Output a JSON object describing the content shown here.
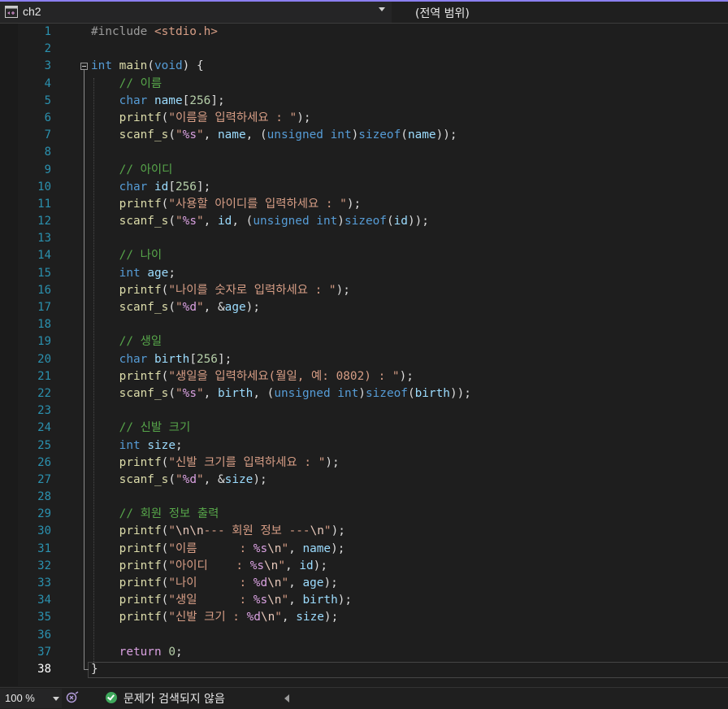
{
  "navbar": {
    "project_name": "ch2",
    "scope": "(전역 범위)"
  },
  "editor": {
    "current_line": 38,
    "lines": [
      {
        "n": "1",
        "tokens": [
          {
            "t": "#include ",
            "c": "pp"
          },
          {
            "t": "<stdio.h>",
            "c": "inc"
          }
        ]
      },
      {
        "n": "2",
        "tokens": []
      },
      {
        "n": "3",
        "tokens": [
          {
            "t": "int",
            "c": "kw"
          },
          {
            "t": " "
          },
          {
            "t": "main",
            "c": "fn"
          },
          {
            "t": "("
          },
          {
            "t": "void",
            "c": "kw"
          },
          {
            "t": ") {"
          }
        ]
      },
      {
        "n": "4",
        "tokens": [
          {
            "t": "    "
          },
          {
            "t": "// 이름",
            "c": "cm"
          }
        ]
      },
      {
        "n": "5",
        "tokens": [
          {
            "t": "    "
          },
          {
            "t": "char",
            "c": "kw"
          },
          {
            "t": " "
          },
          {
            "t": "name",
            "c": "var"
          },
          {
            "t": "["
          },
          {
            "t": "256",
            "c": "num"
          },
          {
            "t": "];"
          }
        ]
      },
      {
        "n": "6",
        "tokens": [
          {
            "t": "    "
          },
          {
            "t": "printf",
            "c": "fn"
          },
          {
            "t": "("
          },
          {
            "t": "\"이름을 입력하세요 : \"",
            "c": "str"
          },
          {
            "t": ");"
          }
        ]
      },
      {
        "n": "7",
        "tokens": [
          {
            "t": "    "
          },
          {
            "t": "scanf_s",
            "c": "fn"
          },
          {
            "t": "("
          },
          {
            "t": "\"",
            "c": "str"
          },
          {
            "t": "%s",
            "c": "fmt"
          },
          {
            "t": "\"",
            "c": "str"
          },
          {
            "t": ", "
          },
          {
            "t": "name",
            "c": "var"
          },
          {
            "t": ", ("
          },
          {
            "t": "unsigned int",
            "c": "kw"
          },
          {
            "t": ")"
          },
          {
            "t": "sizeof",
            "c": "kw"
          },
          {
            "t": "("
          },
          {
            "t": "name",
            "c": "var"
          },
          {
            "t": "));"
          }
        ]
      },
      {
        "n": "8",
        "tokens": []
      },
      {
        "n": "9",
        "tokens": [
          {
            "t": "    "
          },
          {
            "t": "// 아이디",
            "c": "cm"
          }
        ]
      },
      {
        "n": "10",
        "tokens": [
          {
            "t": "    "
          },
          {
            "t": "char",
            "c": "kw"
          },
          {
            "t": " "
          },
          {
            "t": "id",
            "c": "var"
          },
          {
            "t": "["
          },
          {
            "t": "256",
            "c": "num"
          },
          {
            "t": "];"
          }
        ]
      },
      {
        "n": "11",
        "tokens": [
          {
            "t": "    "
          },
          {
            "t": "printf",
            "c": "fn"
          },
          {
            "t": "("
          },
          {
            "t": "\"사용할 아이디를 입력하세요 : \"",
            "c": "str"
          },
          {
            "t": ");"
          }
        ]
      },
      {
        "n": "12",
        "tokens": [
          {
            "t": "    "
          },
          {
            "t": "scanf_s",
            "c": "fn"
          },
          {
            "t": "("
          },
          {
            "t": "\"",
            "c": "str"
          },
          {
            "t": "%s",
            "c": "fmt"
          },
          {
            "t": "\"",
            "c": "str"
          },
          {
            "t": ", "
          },
          {
            "t": "id",
            "c": "var"
          },
          {
            "t": ", ("
          },
          {
            "t": "unsigned int",
            "c": "kw"
          },
          {
            "t": ")"
          },
          {
            "t": "sizeof",
            "c": "kw"
          },
          {
            "t": "("
          },
          {
            "t": "id",
            "c": "var"
          },
          {
            "t": "));"
          }
        ]
      },
      {
        "n": "13",
        "tokens": []
      },
      {
        "n": "14",
        "tokens": [
          {
            "t": "    "
          },
          {
            "t": "// 나이",
            "c": "cm"
          }
        ]
      },
      {
        "n": "15",
        "tokens": [
          {
            "t": "    "
          },
          {
            "t": "int",
            "c": "kw"
          },
          {
            "t": " "
          },
          {
            "t": "age",
            "c": "var"
          },
          {
            "t": ";"
          }
        ]
      },
      {
        "n": "16",
        "tokens": [
          {
            "t": "    "
          },
          {
            "t": "printf",
            "c": "fn"
          },
          {
            "t": "("
          },
          {
            "t": "\"나이를 숫자로 입력하세요 : \"",
            "c": "str"
          },
          {
            "t": ");"
          }
        ]
      },
      {
        "n": "17",
        "tokens": [
          {
            "t": "    "
          },
          {
            "t": "scanf_s",
            "c": "fn"
          },
          {
            "t": "("
          },
          {
            "t": "\"",
            "c": "str"
          },
          {
            "t": "%d",
            "c": "fmt"
          },
          {
            "t": "\"",
            "c": "str"
          },
          {
            "t": ", &"
          },
          {
            "t": "age",
            "c": "var"
          },
          {
            "t": ");"
          }
        ]
      },
      {
        "n": "18",
        "tokens": []
      },
      {
        "n": "19",
        "tokens": [
          {
            "t": "    "
          },
          {
            "t": "// 생일",
            "c": "cm"
          }
        ]
      },
      {
        "n": "20",
        "tokens": [
          {
            "t": "    "
          },
          {
            "t": "char",
            "c": "kw"
          },
          {
            "t": " "
          },
          {
            "t": "birth",
            "c": "var"
          },
          {
            "t": "["
          },
          {
            "t": "256",
            "c": "num"
          },
          {
            "t": "];"
          }
        ]
      },
      {
        "n": "21",
        "tokens": [
          {
            "t": "    "
          },
          {
            "t": "printf",
            "c": "fn"
          },
          {
            "t": "("
          },
          {
            "t": "\"생일을 입력하세요(월일, 예: 0802) : \"",
            "c": "str"
          },
          {
            "t": ");"
          }
        ]
      },
      {
        "n": "22",
        "tokens": [
          {
            "t": "    "
          },
          {
            "t": "scanf_s",
            "c": "fn"
          },
          {
            "t": "("
          },
          {
            "t": "\"",
            "c": "str"
          },
          {
            "t": "%s",
            "c": "fmt"
          },
          {
            "t": "\"",
            "c": "str"
          },
          {
            "t": ", "
          },
          {
            "t": "birth",
            "c": "var"
          },
          {
            "t": ", ("
          },
          {
            "t": "unsigned int",
            "c": "kw"
          },
          {
            "t": ")"
          },
          {
            "t": "sizeof",
            "c": "kw"
          },
          {
            "t": "("
          },
          {
            "t": "birth",
            "c": "var"
          },
          {
            "t": "));"
          }
        ]
      },
      {
        "n": "23",
        "tokens": []
      },
      {
        "n": "24",
        "tokens": [
          {
            "t": "    "
          },
          {
            "t": "// 신발 크기",
            "c": "cm"
          }
        ]
      },
      {
        "n": "25",
        "tokens": [
          {
            "t": "    "
          },
          {
            "t": "int",
            "c": "kw"
          },
          {
            "t": " "
          },
          {
            "t": "size",
            "c": "var"
          },
          {
            "t": ";"
          }
        ]
      },
      {
        "n": "26",
        "tokens": [
          {
            "t": "    "
          },
          {
            "t": "printf",
            "c": "fn"
          },
          {
            "t": "("
          },
          {
            "t": "\"신발 크기를 입력하세요 : \"",
            "c": "str"
          },
          {
            "t": ");"
          }
        ]
      },
      {
        "n": "27",
        "tokens": [
          {
            "t": "    "
          },
          {
            "t": "scanf_s",
            "c": "fn"
          },
          {
            "t": "("
          },
          {
            "t": "\"",
            "c": "str"
          },
          {
            "t": "%d",
            "c": "fmt"
          },
          {
            "t": "\"",
            "c": "str"
          },
          {
            "t": ", &"
          },
          {
            "t": "size",
            "c": "var"
          },
          {
            "t": ");"
          }
        ]
      },
      {
        "n": "28",
        "tokens": []
      },
      {
        "n": "29",
        "tokens": [
          {
            "t": "    "
          },
          {
            "t": "// 회원 정보 출력",
            "c": "cm"
          }
        ]
      },
      {
        "n": "30",
        "tokens": [
          {
            "t": "    "
          },
          {
            "t": "printf",
            "c": "fn"
          },
          {
            "t": "("
          },
          {
            "t": "\"",
            "c": "str"
          },
          {
            "t": "\\n\\n",
            "c": "esc"
          },
          {
            "t": "--- 회원 정보 ---",
            "c": "str"
          },
          {
            "t": "\\n",
            "c": "esc"
          },
          {
            "t": "\"",
            "c": "str"
          },
          {
            "t": ");"
          }
        ]
      },
      {
        "n": "31",
        "tokens": [
          {
            "t": "    "
          },
          {
            "t": "printf",
            "c": "fn"
          },
          {
            "t": "("
          },
          {
            "t": "\"이름      : ",
            "c": "str"
          },
          {
            "t": "%s",
            "c": "fmt"
          },
          {
            "t": "\\n",
            "c": "esc"
          },
          {
            "t": "\"",
            "c": "str"
          },
          {
            "t": ", "
          },
          {
            "t": "name",
            "c": "var"
          },
          {
            "t": ");"
          }
        ]
      },
      {
        "n": "32",
        "tokens": [
          {
            "t": "    "
          },
          {
            "t": "printf",
            "c": "fn"
          },
          {
            "t": "("
          },
          {
            "t": "\"아이디    : ",
            "c": "str"
          },
          {
            "t": "%s",
            "c": "fmt"
          },
          {
            "t": "\\n",
            "c": "esc"
          },
          {
            "t": "\"",
            "c": "str"
          },
          {
            "t": ", "
          },
          {
            "t": "id",
            "c": "var"
          },
          {
            "t": ");"
          }
        ]
      },
      {
        "n": "33",
        "tokens": [
          {
            "t": "    "
          },
          {
            "t": "printf",
            "c": "fn"
          },
          {
            "t": "("
          },
          {
            "t": "\"나이      : ",
            "c": "str"
          },
          {
            "t": "%d",
            "c": "fmt"
          },
          {
            "t": "\\n",
            "c": "esc"
          },
          {
            "t": "\"",
            "c": "str"
          },
          {
            "t": ", "
          },
          {
            "t": "age",
            "c": "var"
          },
          {
            "t": ");"
          }
        ]
      },
      {
        "n": "34",
        "tokens": [
          {
            "t": "    "
          },
          {
            "t": "printf",
            "c": "fn"
          },
          {
            "t": "("
          },
          {
            "t": "\"생일      : ",
            "c": "str"
          },
          {
            "t": "%s",
            "c": "fmt"
          },
          {
            "t": "\\n",
            "c": "esc"
          },
          {
            "t": "\"",
            "c": "str"
          },
          {
            "t": ", "
          },
          {
            "t": "birth",
            "c": "var"
          },
          {
            "t": ");"
          }
        ]
      },
      {
        "n": "35",
        "tokens": [
          {
            "t": "    "
          },
          {
            "t": "printf",
            "c": "fn"
          },
          {
            "t": "("
          },
          {
            "t": "\"신발 크기 : ",
            "c": "str"
          },
          {
            "t": "%d",
            "c": "fmt"
          },
          {
            "t": "\\n",
            "c": "esc"
          },
          {
            "t": "\"",
            "c": "str"
          },
          {
            "t": ", "
          },
          {
            "t": "size",
            "c": "var"
          },
          {
            "t": ");"
          }
        ]
      },
      {
        "n": "36",
        "tokens": []
      },
      {
        "n": "37",
        "tokens": [
          {
            "t": "    "
          },
          {
            "t": "return",
            "c": "ctl"
          },
          {
            "t": " "
          },
          {
            "t": "0",
            "c": "num"
          },
          {
            "t": ";"
          }
        ]
      },
      {
        "n": "38",
        "tokens": [
          {
            "t": "}"
          }
        ]
      }
    ]
  },
  "statusbar": {
    "zoom": "100 %",
    "issues": "문제가 검색되지 않음"
  },
  "colors": {
    "accent": "#8b7ff0",
    "ok": "#3fa85c"
  }
}
